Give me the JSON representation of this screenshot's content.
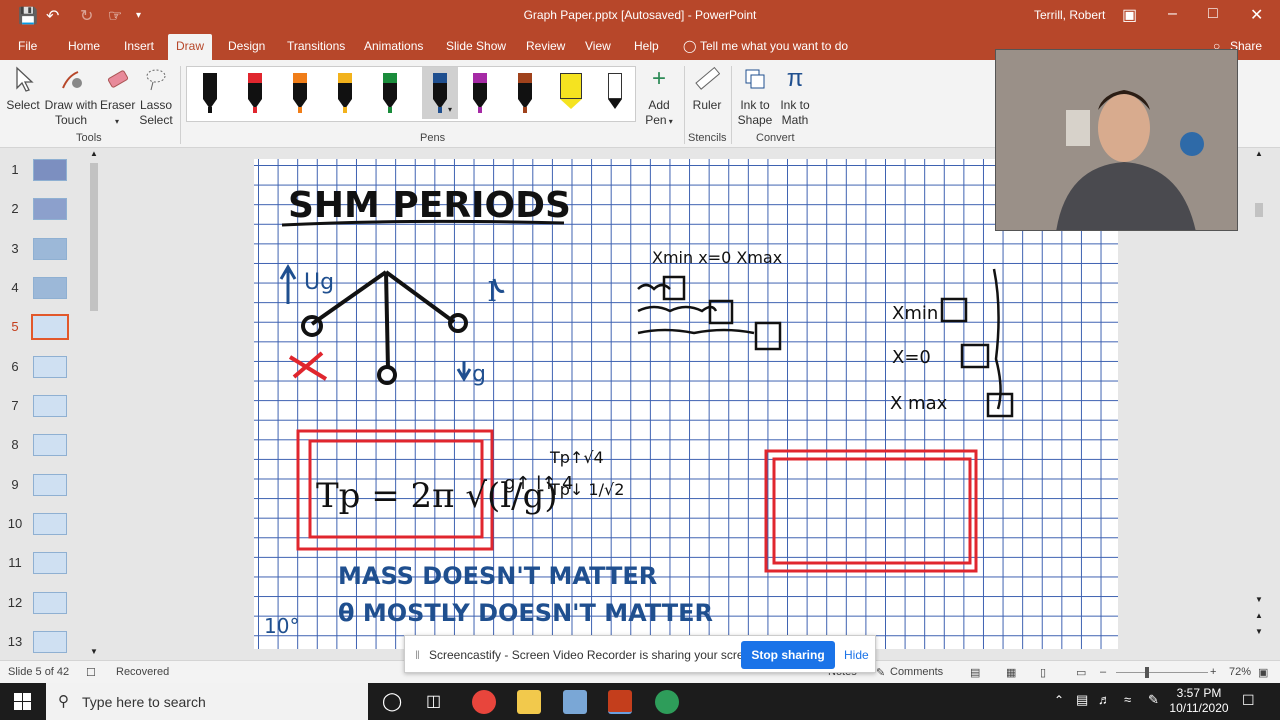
{
  "window": {
    "title": "Graph Paper.pptx [Autosaved]  -  PowerPoint",
    "user": "Terrill, Robert"
  },
  "tabs": [
    "File",
    "Home",
    "Insert",
    "Draw",
    "Design",
    "Transitions",
    "Animations",
    "Slide Show",
    "Review",
    "View",
    "Help"
  ],
  "active_tab": "Draw",
  "tell_me": "Tell me what you want to do",
  "share": "Share",
  "ribbon": {
    "tools": {
      "select": "Select",
      "draw_touch_1": "Draw with",
      "draw_touch_2": "Touch",
      "eraser": "Eraser",
      "lasso_1": "Lasso",
      "lasso_2": "Select",
      "group": "Tools"
    },
    "pens_group": "Pens",
    "pen_colors": [
      "#111111",
      "#e0262e",
      "#f07d18",
      "#f2b21c",
      "#1a8c3b",
      "#1f4f8f",
      "#a52aa5",
      "#a0421c",
      "#f5e320",
      "#ffffff"
    ],
    "add_pen_1": "Add",
    "add_pen_2": "Pen",
    "ruler": "Ruler",
    "stencils": "Stencils",
    "ink_shape_1": "Ink to",
    "ink_shape_2": "Shape",
    "ink_math_1": "Ink to",
    "ink_math_2": "Math",
    "convert": "Convert"
  },
  "thumbnails": [
    "1",
    "2",
    "3",
    "4",
    "5",
    "6",
    "7",
    "8",
    "9",
    "10",
    "11",
    "12",
    "13"
  ],
  "active_slide": "5",
  "slide": {
    "title_ink": "SHM PERIODS",
    "formula_left": "Tp = 2π √(l/g)",
    "note_mass": "MASS DOESN'T MATTER",
    "note_theta": "θ MOSTLY DOESN'T MATTER",
    "angle": "10°"
  },
  "status": {
    "slide_of": "Slide 5 of 42",
    "recovered": "Recovered",
    "notes": "Notes",
    "comments": "Comments",
    "zoom": "72%"
  },
  "banner": {
    "text": "Screencastify - Screen Video Recorder is sharing your screen.",
    "stop": "Stop sharing",
    "hide": "Hide"
  },
  "taskbar": {
    "search": "Type here to search",
    "time": "3:57 PM",
    "date": "10/11/2020"
  }
}
